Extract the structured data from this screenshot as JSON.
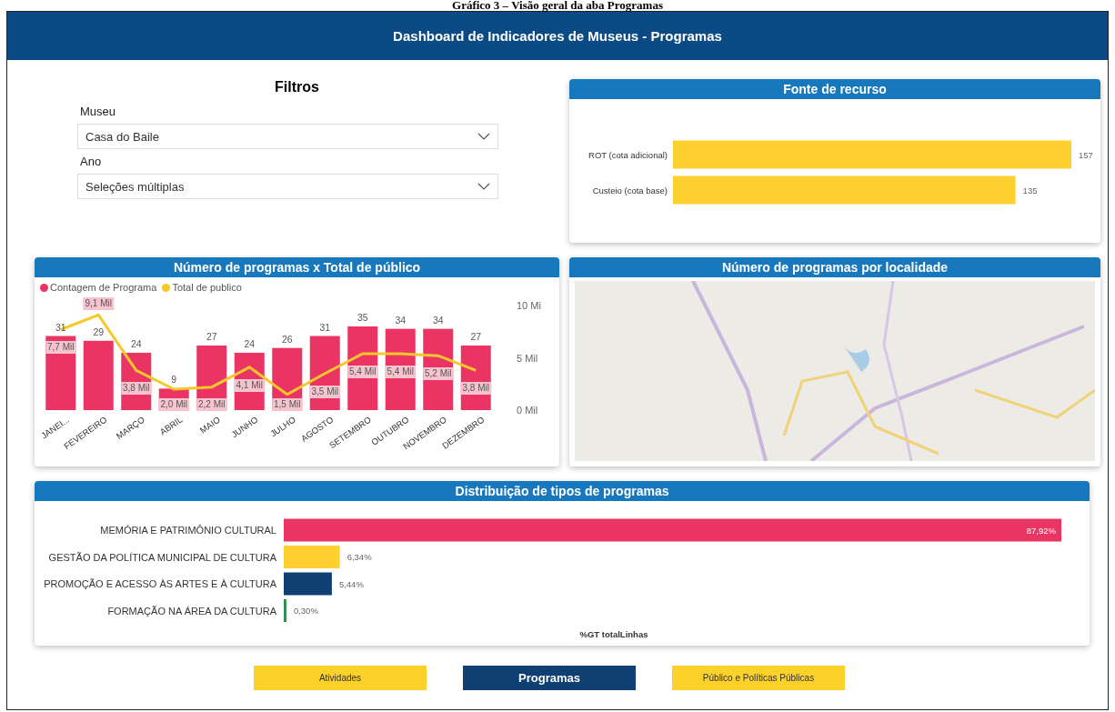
{
  "caption": "Gráfico 3 – Visão geral da aba Programas",
  "header": {
    "title": "Dashboard de Indicadores de Museus  - Programas"
  },
  "filters": {
    "title": "Filtros",
    "fields": [
      {
        "label": "Museu",
        "value": "Casa do Baile"
      },
      {
        "label": "Ano",
        "value": "Seleções múltiplas"
      }
    ]
  },
  "funding": {
    "title": "Fonte de recurso",
    "chart_data": {
      "type": "bar",
      "orientation": "horizontal",
      "categories": [
        "ROT (cota adicional)",
        "Custeio (cota base)"
      ],
      "values": [
        157,
        135
      ],
      "data_labels": true,
      "color": "#fdd02f"
    }
  },
  "programs_audience": {
    "title": "Número de programas x Total de público",
    "counts": {
      "chart_data": {
        "type": "bar",
        "categories": [
          "JANEI...",
          "FEVEREIRO",
          "MARÇO",
          "ABRIL",
          "MAIO",
          "JUNHO",
          "JULHO",
          "AGOSTO",
          "SETEMBRO",
          "OUTUBRO",
          "NOVEMBRO",
          "DEZEMBRO"
        ],
        "series": [
          {
            "name": "Contagem de Programa",
            "color": "#ea3463",
            "values": [
              31,
              29,
              24,
              9,
              27,
              24,
              26,
              31,
              35,
              34,
              34,
              27
            ],
            "value_labels": [
              "31",
              "29",
              "24",
              "9",
              "27",
              "24",
              "26",
              "31",
              "35",
              "34",
              "34",
              "27"
            ]
          }
        ],
        "data_labels": true
      }
    },
    "audience": {
      "chart_data": {
        "type": "line",
        "series": [
          {
            "name": "Total de publico",
            "color": "#f7c82c",
            "values": [
              7.7,
              9.1,
              3.8,
              2.0,
              2.2,
              4.1,
              1.5,
              3.5,
              5.4,
              5.4,
              5.2,
              3.8
            ],
            "value_labels": [
              "7,7 Mil",
              "9,1 Mil",
              "3,8 Mil",
              "2,0 Mil",
              "2,2 Mil",
              "4,1 Mil",
              "1,5 Mil",
              "3,5 Mil",
              "5,4 Mil",
              "5,4 Mil",
              "5,2 Mil",
              "3,8 Mil"
            ]
          }
        ],
        "ylim": [
          0,
          10
        ],
        "yticks": [
          {
            "value": 0,
            "label": "0 Mil"
          },
          {
            "value": 5,
            "label": "5 Mil"
          },
          {
            "value": 10,
            "label": "10 Mi"
          }
        ],
        "data_labels": true
      }
    }
  },
  "map": {
    "title": "Número de programas por localidade"
  },
  "types": {
    "title": "Distribuição de tipos de programas",
    "chart_data": {
      "type": "bar",
      "orientation": "horizontal",
      "xlabel": "%GT totalLinhas",
      "categories": [
        "MEMÓRIA E PATRIMÔNIO CULTURAL",
        "GESTÃO DA POLÍTICA MUNICIPAL DE CULTURA",
        "PROMOÇÃO E ACESSO ÀS ARTES E À CULTURA",
        "FORMAÇÃO NA ÁREA DA CULTURA"
      ],
      "values": [
        87.92,
        6.34,
        5.44,
        0.3
      ],
      "value_labels": [
        "87,92%",
        "6,34%",
        "5,44%",
        "0,30%"
      ],
      "colors": [
        "#ea3463",
        "#fdd02f",
        "#0f3f73",
        "#2f8f4e"
      ]
    }
  },
  "nav": [
    {
      "label": "Atividades",
      "selected": false
    },
    {
      "label": "Programas",
      "selected": true
    },
    {
      "label": "Público e Políticas Públicas",
      "selected": false
    }
  ]
}
